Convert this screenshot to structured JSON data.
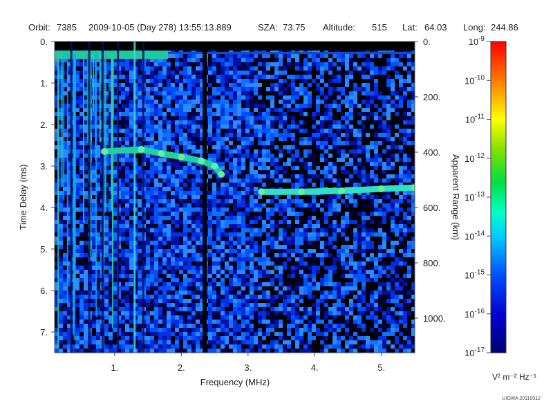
{
  "header": {
    "orbit_label": "Orbit:",
    "orbit_value": "7385",
    "datetime": "2009-10-05 (Day 278) 13:55:13.889",
    "sza_label": "SZA:",
    "sza_value": "73.75",
    "altitude_label": "Altitude:",
    "altitude_value": "515",
    "lat_label": "Lat:",
    "lat_value": "64.03",
    "long_label": "Long:",
    "long_value": "244.86"
  },
  "footer": "UIOWA 20110512",
  "chart_data": {
    "type": "heatmap",
    "title": "",
    "xlabel": "Frequency (MHz)",
    "ylabel": "Time Delay (ms)",
    "y2label": "Apparent Range (km)",
    "xlim": [
      0.1,
      5.5
    ],
    "ylim": [
      7.5,
      0
    ],
    "x_ticks": [
      1,
      2,
      3,
      4,
      5
    ],
    "x_tick_labels": [
      "1.",
      "2.",
      "3.",
      "4.",
      "5."
    ],
    "y_ticks": [
      0,
      1,
      2,
      3,
      4,
      5,
      6,
      7
    ],
    "y_tick_labels": [
      "0.",
      "1.",
      "2.",
      "3.",
      "4.",
      "5.",
      "6.",
      "7."
    ],
    "y2_ticks": [
      0,
      200,
      400,
      600,
      800,
      1000
    ],
    "y2_tick_labels": [
      "0.",
      "200.",
      "400.",
      "600.",
      "800.",
      "1000."
    ],
    "y2lim": [
      0,
      1125
    ],
    "colorbar": {
      "scale": "log",
      "range": [
        1e-17,
        1e-09
      ],
      "unit_label": "V² m⁻² Hz⁻¹",
      "tick_labels": [
        {
          "mant": "10",
          "exp": "-9"
        },
        {
          "mant": "10",
          "exp": "-10"
        },
        {
          "mant": "10",
          "exp": "-11"
        },
        {
          "mant": "10",
          "exp": "-12"
        },
        {
          "mant": "10",
          "exp": "-13"
        },
        {
          "mant": "10",
          "exp": "-14"
        },
        {
          "mant": "10",
          "exp": "-15"
        },
        {
          "mant": "10",
          "exp": "-16"
        },
        {
          "mant": "10",
          "exp": "-17"
        }
      ]
    },
    "features": {
      "vertical_lines_mhz": [
        0.35,
        0.62,
        0.82,
        1.05,
        1.3,
        1.43,
        2.35
      ],
      "surface_echo_1": [
        {
          "x": 0.85,
          "y": 2.65
        },
        {
          "x": 1.4,
          "y": 2.6
        },
        {
          "x": 1.7,
          "y": 2.7
        },
        {
          "x": 2.0,
          "y": 2.78
        },
        {
          "x": 2.3,
          "y": 2.88
        },
        {
          "x": 2.5,
          "y": 3.0
        },
        {
          "x": 2.6,
          "y": 3.2
        }
      ],
      "surface_echo_2": [
        {
          "x": 3.2,
          "y": 3.62
        },
        {
          "x": 3.8,
          "y": 3.62
        },
        {
          "x": 4.4,
          "y": 3.6
        },
        {
          "x": 5.0,
          "y": 3.55
        },
        {
          "x": 5.5,
          "y": 3.52
        }
      ]
    }
  }
}
